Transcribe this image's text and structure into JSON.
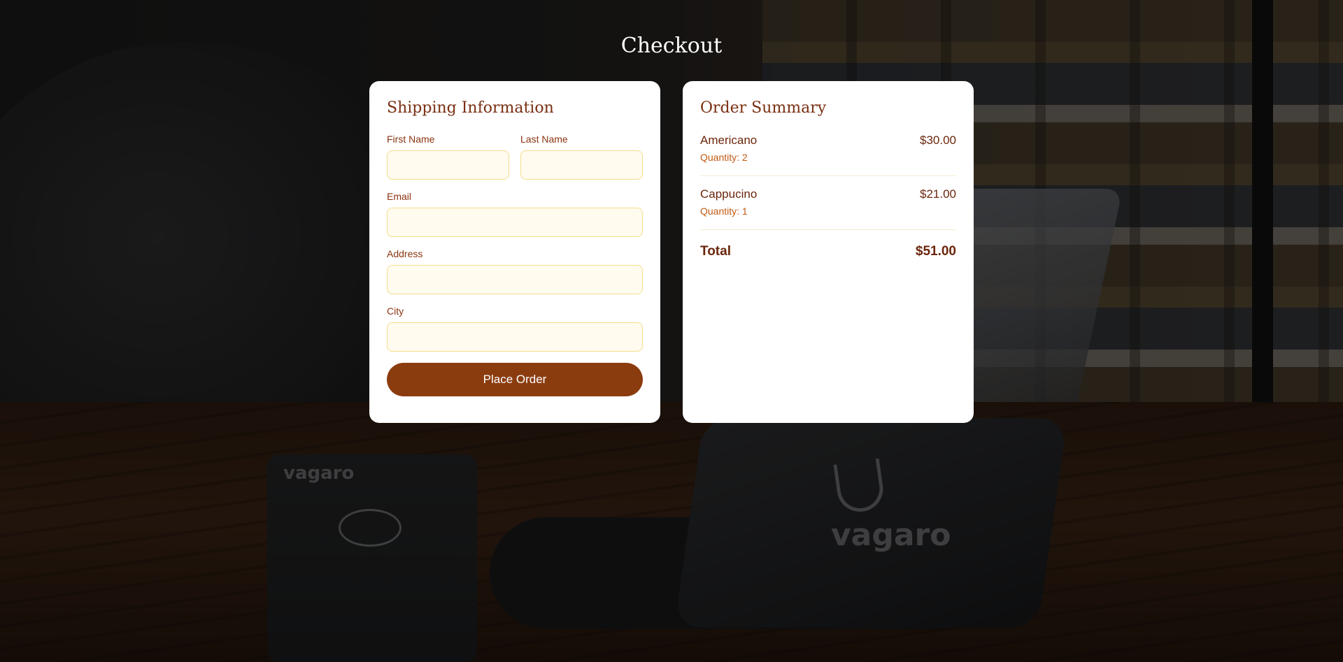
{
  "page": {
    "title": "Checkout"
  },
  "shipping": {
    "title": "Shipping Information",
    "fields": {
      "first_name": {
        "label": "First Name",
        "value": "",
        "placeholder": ""
      },
      "last_name": {
        "label": "Last Name",
        "value": "",
        "placeholder": ""
      },
      "email": {
        "label": "Email",
        "value": "",
        "placeholder": ""
      },
      "address": {
        "label": "Address",
        "value": "",
        "placeholder": ""
      },
      "city": {
        "label": "City",
        "value": "",
        "placeholder": ""
      }
    },
    "submit_label": "Place Order"
  },
  "summary": {
    "title": "Order Summary",
    "items": [
      {
        "name": "Americano",
        "quantity": "Quantity: 2",
        "price": "$30.00"
      },
      {
        "name": "Cappucino",
        "quantity": "Quantity: 1",
        "price": "$21.00"
      }
    ],
    "total_label": "Total",
    "total_value": "$51.00"
  },
  "background": {
    "reader_logo": "vagaro",
    "stand_logo": "vagaro"
  },
  "colors": {
    "accent": "#8b3c0f",
    "heading": "#7a2f12",
    "input_bg": "#fffbee",
    "input_border": "#f3dd8c"
  }
}
